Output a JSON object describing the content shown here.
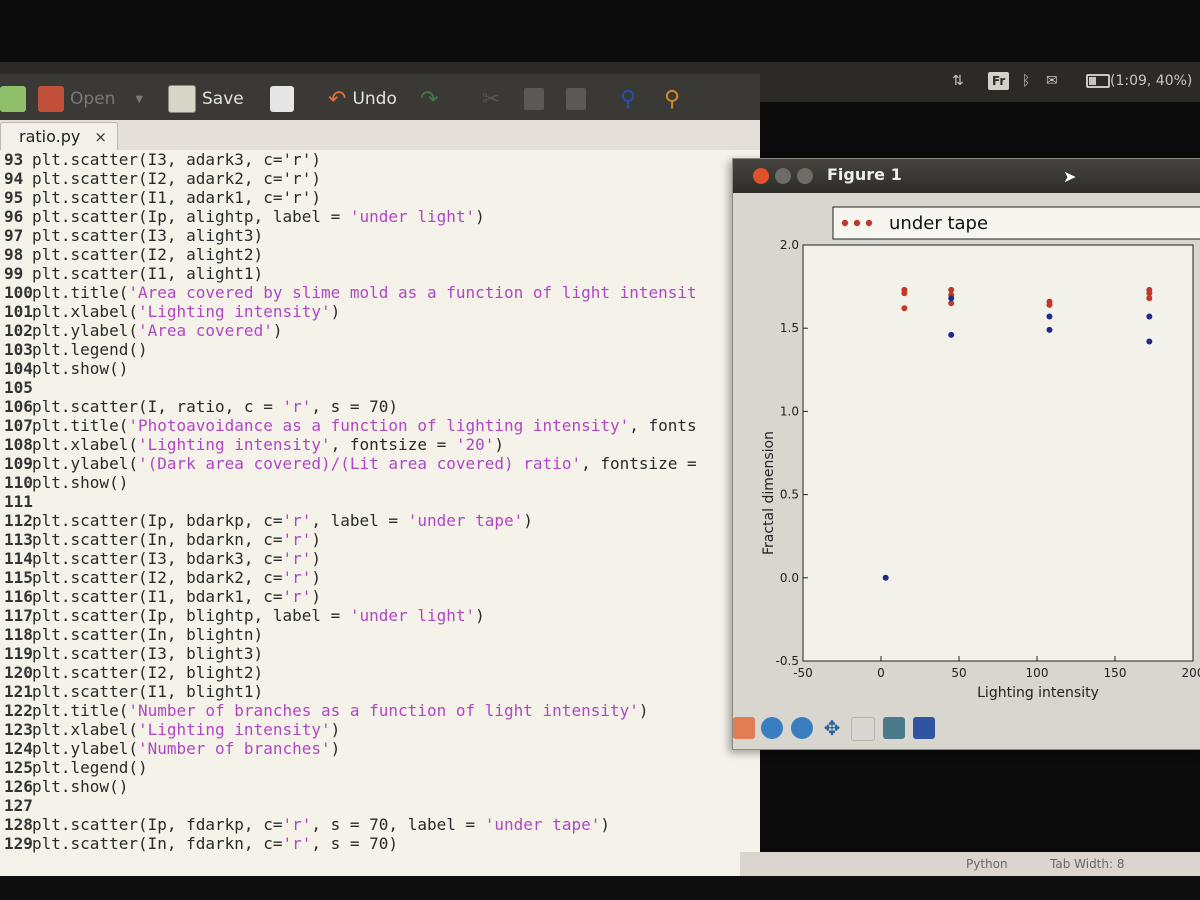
{
  "toolbar": {
    "open_label": "Open",
    "save_label": "Save",
    "undo_label": "Undo"
  },
  "system_tray": {
    "language": "Fr",
    "battery_text": "(1:09, 40%)"
  },
  "tab": {
    "filename": "ratio.py",
    "close_glyph": "×"
  },
  "editor": {
    "lines": [
      {
        "n": "93",
        "parts": [
          [
            "t",
            "plt.scatter(I3, adark3, c='r')"
          ]
        ]
      },
      {
        "n": "94",
        "parts": [
          [
            "t",
            "plt.scatter(I2, adark2, c='r')"
          ]
        ]
      },
      {
        "n": "95",
        "parts": [
          [
            "t",
            "plt.scatter(I1, adark1, c='r')"
          ]
        ]
      },
      {
        "n": "96",
        "parts": [
          [
            "t",
            "plt.scatter(Ip, alightp, label = "
          ],
          [
            "s",
            "'under light'"
          ],
          [
            "t",
            ")"
          ]
        ]
      },
      {
        "n": "97",
        "parts": [
          [
            "t",
            "plt.scatter(I3, alight3)"
          ]
        ]
      },
      {
        "n": "98",
        "parts": [
          [
            "t",
            "plt.scatter(I2, alight2)"
          ]
        ]
      },
      {
        "n": "99",
        "parts": [
          [
            "t",
            "plt.scatter(I1, alight1)"
          ]
        ]
      },
      {
        "n": "100",
        "parts": [
          [
            "t",
            "plt.title("
          ],
          [
            "s",
            "'Area covered by slime mold as a function of light intensit"
          ]
        ]
      },
      {
        "n": "101",
        "parts": [
          [
            "t",
            "plt.xlabel("
          ],
          [
            "s",
            "'Lighting intensity'"
          ],
          [
            "t",
            ")"
          ]
        ]
      },
      {
        "n": "102",
        "parts": [
          [
            "t",
            "plt.ylabel("
          ],
          [
            "s",
            "'Area covered'"
          ],
          [
            "t",
            ")"
          ]
        ]
      },
      {
        "n": "103",
        "parts": [
          [
            "t",
            "plt.legend()"
          ]
        ]
      },
      {
        "n": "104",
        "parts": [
          [
            "t",
            "plt.show()"
          ]
        ]
      },
      {
        "n": "105",
        "parts": [
          [
            "t",
            ""
          ]
        ]
      },
      {
        "n": "106",
        "parts": [
          [
            "t",
            "plt.scatter(I, ratio, c = "
          ],
          [
            "s",
            "'r'"
          ],
          [
            "t",
            ", s = 70)"
          ]
        ]
      },
      {
        "n": "107",
        "parts": [
          [
            "t",
            "plt.title("
          ],
          [
            "s",
            "'Photoavoidance as a function of lighting intensity'"
          ],
          [
            "t",
            ", fonts"
          ]
        ]
      },
      {
        "n": "108",
        "parts": [
          [
            "t",
            "plt.xlabel("
          ],
          [
            "s",
            "'Lighting intensity'"
          ],
          [
            "t",
            ", fontsize = "
          ],
          [
            "s",
            "'20'"
          ],
          [
            "t",
            ")"
          ]
        ]
      },
      {
        "n": "109",
        "parts": [
          [
            "t",
            "plt.ylabel("
          ],
          [
            "s",
            "'(Dark area covered)/(Lit area covered) ratio'"
          ],
          [
            "t",
            ", fontsize ="
          ]
        ]
      },
      {
        "n": "110",
        "parts": [
          [
            "t",
            "plt.show()"
          ]
        ]
      },
      {
        "n": "111",
        "parts": [
          [
            "t",
            ""
          ]
        ]
      },
      {
        "n": "112",
        "parts": [
          [
            "t",
            "plt.scatter(Ip, bdarkp, c="
          ],
          [
            "s",
            "'r'"
          ],
          [
            "t",
            ", label = "
          ],
          [
            "s",
            "'under tape'"
          ],
          [
            "t",
            ")"
          ]
        ]
      },
      {
        "n": "113",
        "parts": [
          [
            "t",
            "plt.scatter(In, bdarkn, c="
          ],
          [
            "s",
            "'r'"
          ],
          [
            "t",
            ")"
          ]
        ]
      },
      {
        "n": "114",
        "parts": [
          [
            "t",
            "plt.scatter(I3, bdark3, c="
          ],
          [
            "s",
            "'r'"
          ],
          [
            "t",
            ")"
          ]
        ]
      },
      {
        "n": "115",
        "parts": [
          [
            "t",
            "plt.scatter(I2, bdark2, c="
          ],
          [
            "s",
            "'r'"
          ],
          [
            "t",
            ")"
          ]
        ]
      },
      {
        "n": "116",
        "parts": [
          [
            "t",
            "plt.scatter(I1, bdark1, c="
          ],
          [
            "s",
            "'r'"
          ],
          [
            "t",
            ")"
          ]
        ]
      },
      {
        "n": "117",
        "parts": [
          [
            "t",
            "plt.scatter(Ip, blightp, label = "
          ],
          [
            "s",
            "'under light'"
          ],
          [
            "t",
            ")"
          ]
        ]
      },
      {
        "n": "118",
        "parts": [
          [
            "t",
            "plt.scatter(In, blightn)"
          ]
        ]
      },
      {
        "n": "119",
        "parts": [
          [
            "t",
            "plt.scatter(I3, blight3)"
          ]
        ]
      },
      {
        "n": "120",
        "parts": [
          [
            "t",
            "plt.scatter(I2, blight2)"
          ]
        ]
      },
      {
        "n": "121",
        "parts": [
          [
            "t",
            "plt.scatter(I1, blight1)"
          ]
        ]
      },
      {
        "n": "122",
        "parts": [
          [
            "t",
            "plt.title("
          ],
          [
            "s",
            "'Number of branches as a function of light intensity'"
          ],
          [
            "t",
            ")"
          ]
        ]
      },
      {
        "n": "123",
        "parts": [
          [
            "t",
            "plt.xlabel("
          ],
          [
            "s",
            "'Lighting intensity'"
          ],
          [
            "t",
            ")"
          ]
        ]
      },
      {
        "n": "124",
        "parts": [
          [
            "t",
            "plt.ylabel("
          ],
          [
            "s",
            "'Number of branches'"
          ],
          [
            "t",
            ")"
          ]
        ]
      },
      {
        "n": "125",
        "parts": [
          [
            "t",
            "plt.legend()"
          ]
        ]
      },
      {
        "n": "126",
        "parts": [
          [
            "t",
            "plt.show()"
          ]
        ]
      },
      {
        "n": "127",
        "parts": [
          [
            "t",
            ""
          ]
        ]
      },
      {
        "n": "128",
        "parts": [
          [
            "t",
            "plt.scatter(Ip, fdarkp, c="
          ],
          [
            "s",
            "'r'"
          ],
          [
            "t",
            ", s = 70, label = "
          ],
          [
            "s",
            "'under tape'"
          ],
          [
            "t",
            ")"
          ]
        ]
      },
      {
        "n": "129",
        "parts": [
          [
            "t",
            "plt.scatter(In, fdarkn, c="
          ],
          [
            "s",
            "'r'"
          ],
          [
            "t",
            ", s = 70)"
          ]
        ]
      }
    ]
  },
  "status_bar": {
    "language": "Python",
    "tab_width": "Tab Width: 8"
  },
  "figure": {
    "window_title": "Figure 1"
  },
  "chart_data": {
    "type": "scatter",
    "xlabel": "Lighting intensity",
    "ylabel": "Fractal dimension",
    "xlim": [
      -50,
      200
    ],
    "ylim": [
      -0.5,
      2.0
    ],
    "xticks": [
      -50,
      0,
      50,
      100,
      150,
      200
    ],
    "yticks": [
      -0.5,
      0.0,
      0.5,
      1.0,
      1.5,
      2.0
    ],
    "legend": {
      "position": "top",
      "entries": [
        "under tape"
      ]
    },
    "series": [
      {
        "name": "under tape",
        "color": "#c0392b",
        "points": [
          [
            15,
            1.73
          ],
          [
            15,
            1.71
          ],
          [
            15,
            1.62
          ],
          [
            45,
            1.73
          ],
          [
            45,
            1.7
          ],
          [
            45,
            1.65
          ],
          [
            108,
            1.66
          ],
          [
            108,
            1.64
          ],
          [
            172,
            1.73
          ],
          [
            172,
            1.71
          ],
          [
            172,
            1.68
          ]
        ]
      },
      {
        "color": "#1f2a8c",
        "points": [
          [
            3,
            0.0
          ],
          [
            45,
            1.68
          ],
          [
            45,
            1.46
          ],
          [
            108,
            1.57
          ],
          [
            108,
            1.49
          ],
          [
            172,
            1.57
          ],
          [
            172,
            1.42
          ]
        ]
      }
    ],
    "grid": false
  }
}
